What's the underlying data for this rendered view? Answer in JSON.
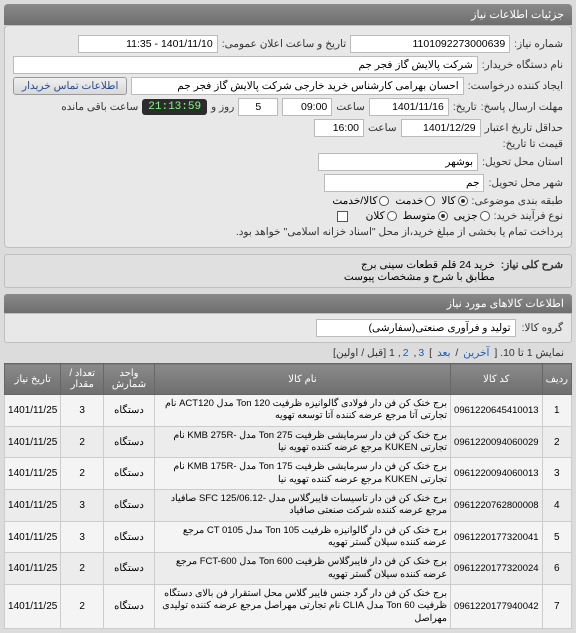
{
  "header": {
    "title": "جزئیات اطلاعات نیاز"
  },
  "info": {
    "need_no_label": "شماره نیاز:",
    "need_no": "1101092273000639",
    "pub_datetime_label": "تاریخ و ساعت اعلان عمومی:",
    "pub_datetime": "1401/11/10 - 11:35",
    "buyer_org_label": "نام دستگاه خریدار:",
    "buyer_org": "شرکت پالایش گاز فجر جم",
    "creator_label": "ایجاد کننده درخواست:",
    "creator": "احسان بهرامی کارشناس خرید خارجی شرکت پالایش گاز فجر جم",
    "buyer_contact_btn": "اطلاعات تماس خریدار",
    "deadline_label": "مهلت ارسال پاسخ:",
    "deadline_word_date": "تاریخ:",
    "deadline_date": "1401/11/16",
    "deadline_word_time": "ساعت",
    "deadline_time": "09:00",
    "deadline_days": "5",
    "deadline_days_suffix": "روز و",
    "deadline_timer": "21:13:59",
    "deadline_remain": "ساعت باقی مانده",
    "validity_label": "حداقل تاریخ اعتبار",
    "validity_label2": "قیمت تا تاریخ:",
    "validity_date": "1401/12/29",
    "validity_time": "16:00",
    "province_label": "استان محل تحویل:",
    "province": "بوشهر",
    "city_label": "شهر محل تحویل:",
    "city": "جم",
    "category_label": "طبقه بندی موضوعی:",
    "cat_opts": [
      "کالا",
      "خدمت",
      "کالا/خدمت"
    ],
    "cat_selected": 0,
    "purchase_type_label": "نوع فرآیند خرید:",
    "pt_opts": [
      "جزیی",
      "متوسط",
      "کلان"
    ],
    "pt_selected": 1,
    "pay_note": "پرداخت تمام یا بخشی از مبلغ خرید،از محل \"اسناد خزانه اسلامی\" خواهد بود.",
    "checkbox": false
  },
  "desc": {
    "label": "شرح کلی نیاز:",
    "line1": "خرید 24 قلم قطعات سینی برج",
    "line2": "مطابق با شرح و مشخصات پیوست"
  },
  "items_title": "اطلاعات کالاهای مورد نیاز",
  "group": {
    "label": "گروه کالا:",
    "value": "تولید و فرآوری صنعتی(سفارشی)"
  },
  "pager": {
    "text_prefix": "نمایش 1 تا 10. [ ",
    "last": "آخرین",
    "sep1": " / ",
    "next": "بعد",
    "sep2": " ] ",
    "p3": "3",
    "p2": "2",
    "p1": "1",
    "suffix": " [قبل / اولین]"
  },
  "table": {
    "headers": [
      "ردیف",
      "کد کالا",
      "نام کالا",
      "واحد شمارش",
      "تعداد / مقدار",
      "تاریخ نیاز"
    ],
    "rows": [
      {
        "n": "1",
        "code": "0961220645410013",
        "name": "برج خنک کن فن دار فولادی گالوانیزه ظرفیت Ton 120 مدل ACT120 نام تجارتی آتا مرجع عرضه کننده آتا توسعه تهویه",
        "unit": "دستگاه",
        "qty": "3",
        "date": "1401/11/25"
      },
      {
        "n": "2",
        "code": "0961220094060029",
        "name": "برج خنک کن فن دار سرمایشی ظرفیت Ton 275 مدل -KMB 275R نام تجارتی KUKEN مرجع عرضه کننده تهویه نیا",
        "unit": "دستگاه",
        "qty": "2",
        "date": "1401/11/25"
      },
      {
        "n": "3",
        "code": "0961220094060013",
        "name": "برج خنک کن فن دار سرمایشی ظرفیت Ton 175 مدل -KMB 175R نام تجارتی KUKEN مرجع عرضه کننده تهویه نیا",
        "unit": "دستگاه",
        "qty": "2",
        "date": "1401/11/25"
      },
      {
        "n": "4",
        "code": "0961220762800008",
        "name": "برج خنک کن فن دار تاسیسات فایبرگلاس مدل -SFC 125/06.12 صافیاد مرجع عرضه کننده شرکت صنعتی صافیاد",
        "unit": "دستگاه",
        "qty": "3",
        "date": "1401/11/25"
      },
      {
        "n": "5",
        "code": "0961220177320041",
        "name": "برج خنک کن فن دار گالوانیزه ظرفیت Ton 105 مدل CT 0105 مرجع عرضه کننده سیلان گستر تهویه",
        "unit": "دستگاه",
        "qty": "3",
        "date": "1401/11/25"
      },
      {
        "n": "6",
        "code": "0961220177320024",
        "name": "برج خنک کن فن دار فایبرگلاس ظرفیت Ton 600 مدل FCT-600 مرجع عرضه کننده سیلان گستر تهویه",
        "unit": "دستگاه",
        "qty": "2",
        "date": "1401/11/25"
      },
      {
        "n": "7",
        "code": "0961220177940042",
        "name": "برج خنک کن فن دار گرد جنس فایبر گلاس محل استقرار فن بالای دستگاه ظرفیت Ton 60 مدل CLIA نام تجارتی مهراصل مرجع عرضه کننده تولیدی مهراصل",
        "unit": "دستگاه",
        "qty": "2",
        "date": "1401/11/25"
      }
    ]
  }
}
